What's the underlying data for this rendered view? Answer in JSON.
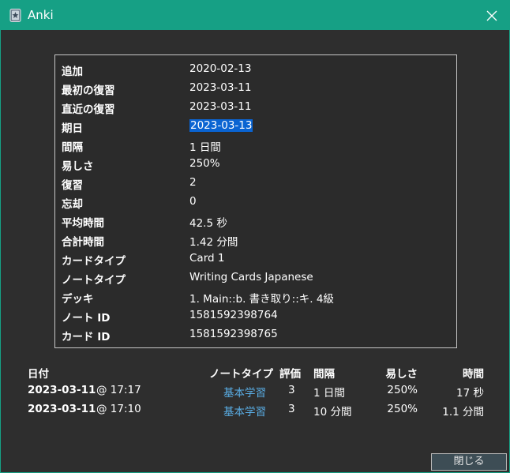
{
  "window": {
    "title": "Anki",
    "accent": "#16a085"
  },
  "info": {
    "rows": [
      {
        "label": "追加",
        "value": "2020-02-13"
      },
      {
        "label": "最初の復習",
        "value": "2023-03-11"
      },
      {
        "label": "直近の復習",
        "value": "2023-03-11"
      },
      {
        "label": "期日",
        "value": "2023-03-13"
      },
      {
        "label": "間隔",
        "value": "1 日間"
      },
      {
        "label": "易しさ",
        "value": "250%"
      },
      {
        "label": "復習",
        "value": "2"
      },
      {
        "label": "忘却",
        "value": "0"
      },
      {
        "label": "平均時間",
        "value": "42.5 秒"
      },
      {
        "label": "合計時間",
        "value": "1.42 分間"
      },
      {
        "label": "カードタイプ",
        "value": "Card 1"
      },
      {
        "label": "ノートタイプ",
        "value": "Writing Cards Japanese"
      },
      {
        "label": "デッキ",
        "value": "1. Main::b. 書き取り::キ. 4級"
      },
      {
        "label": "ノート ID",
        "value": "1581592398764"
      },
      {
        "label": "カード ID",
        "value": "1581592398765"
      }
    ]
  },
  "reviews": {
    "headers": {
      "date": "日付",
      "type": "ノートタイプ",
      "rating": "評価",
      "interval": "間隔",
      "ease": "易しさ",
      "time": "時間"
    },
    "rows": [
      {
        "date": "2023-03-11",
        "time_of_day": "@ 17:17",
        "type": "基本学習",
        "rating": "3",
        "interval": "1 日間",
        "ease": "250%",
        "time": "17 秒"
      },
      {
        "date": "2023-03-11",
        "time_of_day": "@ 17:10",
        "type": "基本学習",
        "rating": "3",
        "interval": "10 分間",
        "ease": "250%",
        "time": "1.1 分間"
      }
    ]
  },
  "buttons": {
    "close": "閉じる"
  }
}
